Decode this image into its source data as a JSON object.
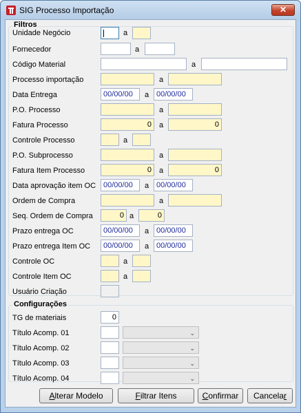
{
  "window": {
    "title": "SIG Processo Importação",
    "close_label": "✕"
  },
  "separator": "a",
  "filtros": {
    "title": "Filtros",
    "rows": [
      {
        "label": "Unidade Negócio",
        "from": "",
        "to": ""
      },
      {
        "label": "Fornecedor",
        "from": "",
        "to": ""
      },
      {
        "label": "Código Material",
        "from": "",
        "to": ""
      },
      {
        "label": "Processo importação",
        "from": "",
        "to": ""
      },
      {
        "label": "Data Entrega",
        "from": "00/00/00",
        "to": "00/00/00"
      },
      {
        "label": "P.O. Processo",
        "from": "",
        "to": ""
      },
      {
        "label": "Fatura Processo",
        "from": "0",
        "to": "0"
      },
      {
        "label": "Controle Processo",
        "from": "",
        "to": ""
      },
      {
        "label": "P.O. Subprocesso",
        "from": "",
        "to": ""
      },
      {
        "label": "Fatura Item Processo",
        "from": "0",
        "to": "0"
      },
      {
        "label": "Data aprovação item OC",
        "from": "00/00/00",
        "to": "00/00/00"
      },
      {
        "label": "Ordem de Compra",
        "from": "",
        "to": ""
      },
      {
        "label": "Seq. Ordem de Compra",
        "from": "0",
        "to": "0"
      },
      {
        "label": "Prazo entrega OC",
        "from": "00/00/00",
        "to": "00/00/00"
      },
      {
        "label": "Prazo entrega Item OC",
        "from": "00/00/00",
        "to": "00/00/00"
      },
      {
        "label": "Controle OC",
        "from": "",
        "to": ""
      },
      {
        "label": "Controle Item OC",
        "from": "",
        "to": ""
      },
      {
        "label": "Usuário Criação",
        "value": ""
      }
    ]
  },
  "configuracoes": {
    "title": "Configurações",
    "tg_label": "TG de materiais",
    "tg_value": "0",
    "titulos": [
      {
        "label": "Título Acomp. 01",
        "value": "",
        "selected": ""
      },
      {
        "label": "Título Acomp. 02",
        "value": "",
        "selected": ""
      },
      {
        "label": "Título Acomp. 03",
        "value": "",
        "selected": ""
      },
      {
        "label": "Título Acomp. 04",
        "value": "",
        "selected": ""
      }
    ]
  },
  "buttons": {
    "alterar_modelo": {
      "underline": "A",
      "rest": "lterar Modelo"
    },
    "filtrar_itens": {
      "underline": "F",
      "rest": "iltrar Itens"
    },
    "confirmar": {
      "underline": "C",
      "rest": "onfirmar"
    },
    "cancelar": {
      "rest": "Cancela",
      "underline": "r"
    }
  }
}
